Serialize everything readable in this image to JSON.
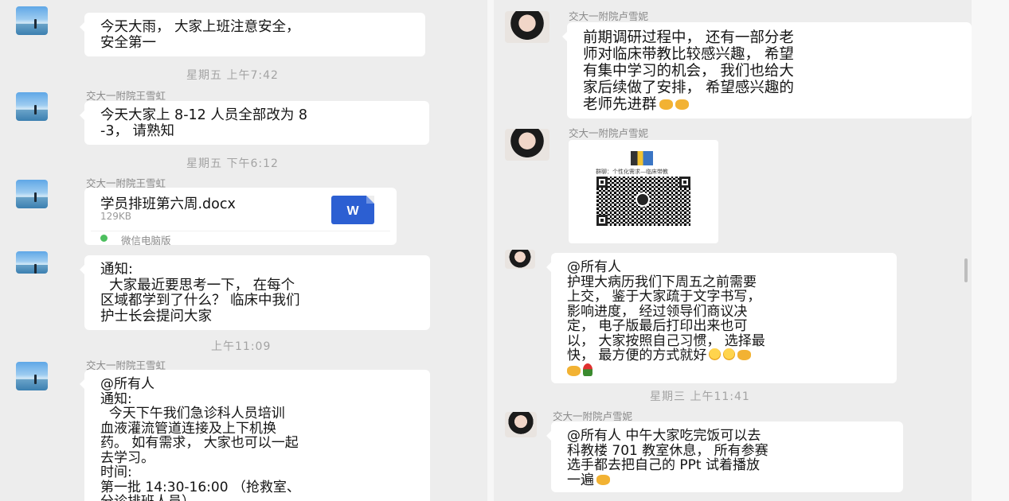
{
  "left_chat": {
    "messages": [
      {
        "sender": "",
        "lines": [
          "今天大雨， 大家上班注意安全，",
          "安全第一"
        ]
      },
      {
        "time": "星期五 上午7:42"
      },
      {
        "sender": "交大一附院王雪虹",
        "lines": [
          "今天大家上 8-12 人员全部改为 8",
          "-3， 请熟知"
        ]
      },
      {
        "time": "星期五 下午6:12"
      },
      {
        "sender": "交大一附院王雪虹",
        "file": {
          "name": "学员排班第六周.docx",
          "size": "129KB",
          "icon": "W",
          "source": "微信电脑版"
        }
      },
      {
        "sender": "",
        "lines": [
          "通知:",
          "  大家最近要思考一下， 在每个",
          "区域都学到了什么？ 临床中我们",
          "护士长会提问大家"
        ]
      },
      {
        "time": "上午11:09"
      },
      {
        "sender": "交大一附院王雪虹",
        "lines": [
          "@所有人",
          "通知:",
          "  今天下午我们急诊科人员培训",
          "血液灌流管道连接及上下机换",
          "药。 如有需求， 大家也可以一起",
          "去学习。",
          "时间:",
          "第一批 14:30-16:00 （抢救室、",
          "分诊排班人员）"
        ]
      }
    ]
  },
  "right_chat": {
    "messages": [
      {
        "sender": "交大一附院卢雪妮",
        "lines": [
          "前期调研过程中， 还有一部分老",
          "师对临床带教比较感兴趣， 希望",
          "有集中学习的机会， 我们也给大",
          "家后续做了安排， 希望感兴趣的",
          "老师先进群"
        ]
      },
      {
        "sender": "交大一附院卢雪妮",
        "qr": {
          "title": "群聊：个性化需求—临床带教"
        }
      },
      {
        "sender": "",
        "lines": [
          "@所有人",
          "护理大病历我们下周五之前需要",
          "上交， 鉴于大家疏于文字书写，",
          "影响进度， 经过领导们商议决",
          "定， 电子版最后打印出来也可",
          "以， 大家按照自己习惯， 选择最",
          "快， 最方便的方式就好"
        ]
      },
      {
        "time": "星期三 上午11:41"
      },
      {
        "sender": "交大一附院卢雪妮",
        "lines": [
          "@所有人 中午大家吃完饭可以去",
          "科教楼 701 教室休息， 所有参赛",
          "选手都去把自己的 PPt 试着播放",
          "一遍"
        ]
      }
    ]
  },
  "colors": {
    "background": "#ededed",
    "bubble": "#ffffff",
    "word_icon": "#2c5fd2",
    "emoji": "#f2b233"
  }
}
